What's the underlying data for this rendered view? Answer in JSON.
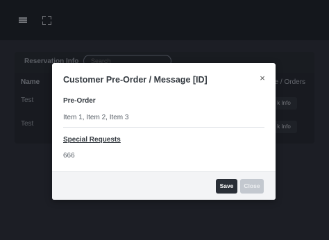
{
  "topbar": {
    "menu_icon": "hamburger-icon",
    "fullscreen_icon": "expand-icon"
  },
  "background": {
    "section_title": "Reservation Info",
    "search_placeholder": "Search",
    "columns": {
      "name": "Name",
      "right": "ge / Orders"
    },
    "rows": [
      {
        "name": "Test",
        "button": "k Info"
      },
      {
        "name": "Test",
        "button": "k Info"
      }
    ]
  },
  "modal": {
    "title": "Customer Pre-Order / Message [ID]",
    "close_symbol": "×",
    "pre_order_label": "Pre-Order",
    "pre_order_value": "Item 1, Item 2, Item 3",
    "special_label": "Special Requests",
    "special_value": "666",
    "save_label": "Save",
    "close_label": "Close"
  },
  "colors": {
    "page_bg": "#2a2f37",
    "topbar_bg": "#1d2127",
    "save_button": "#2a2f37",
    "close_button_disabled": "#c3c8cf"
  }
}
